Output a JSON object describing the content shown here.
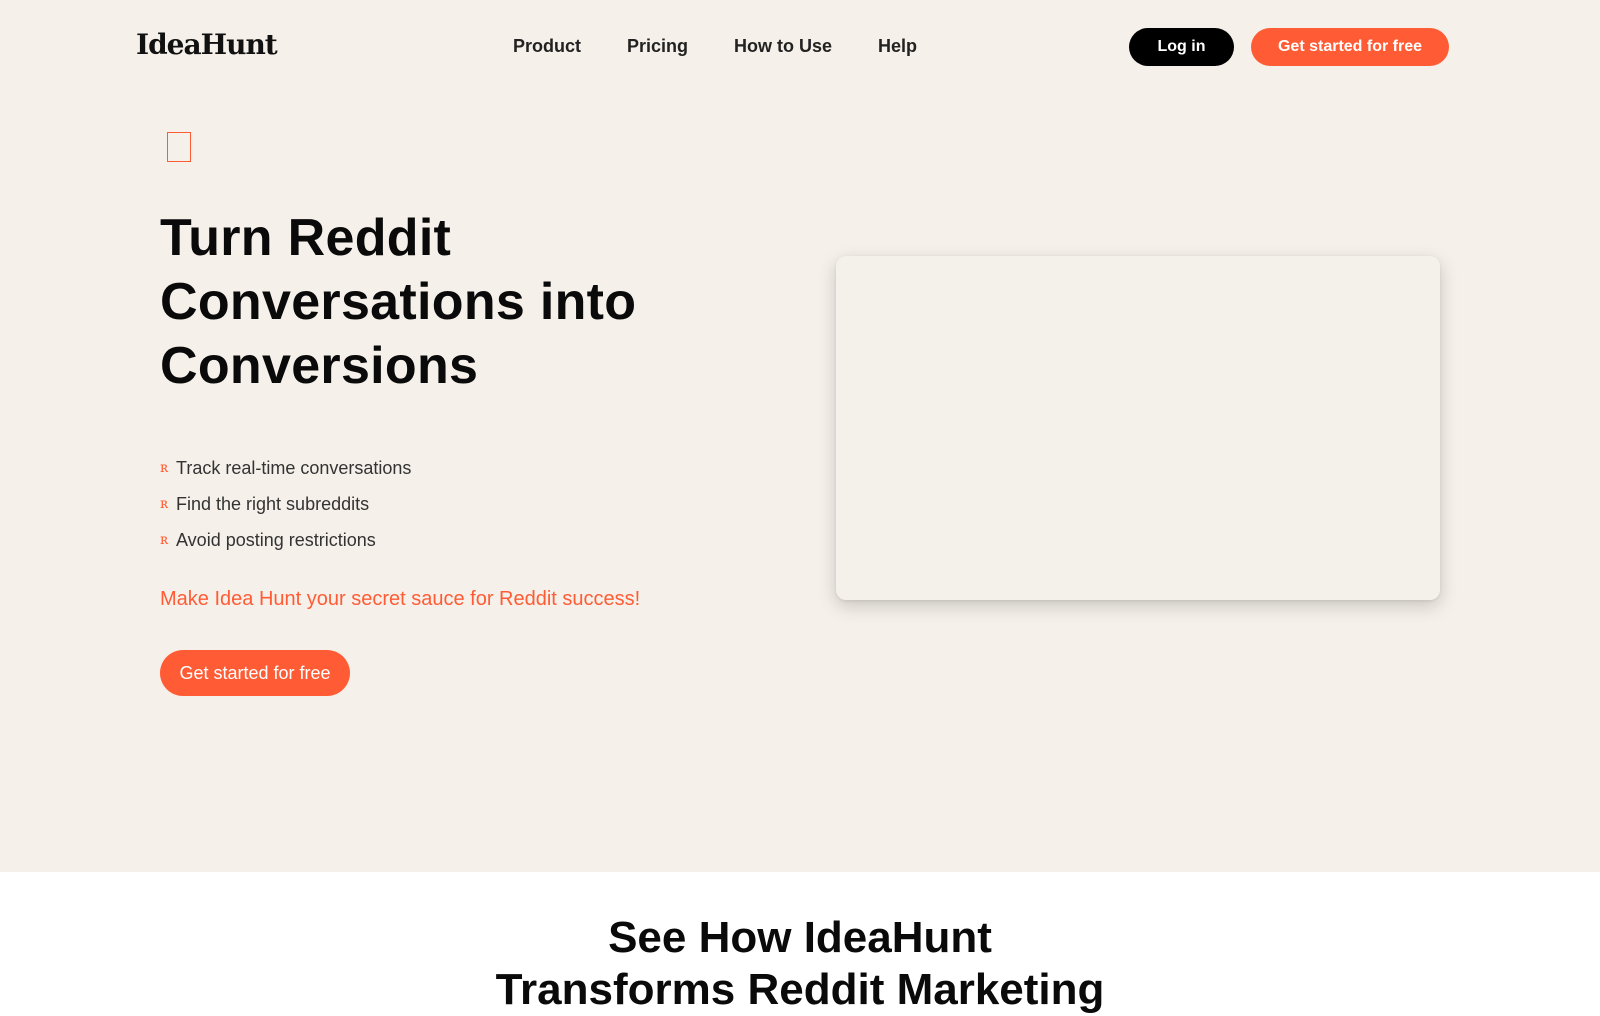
{
  "header": {
    "logo": "IdeaHunt",
    "nav": [
      "Product",
      "Pricing",
      "How to Use",
      "Help"
    ],
    "login_label": "Log in",
    "cta_label": "Get started for free"
  },
  "hero": {
    "title": "Turn Reddit Conversations into Conversions",
    "features": [
      "Track real-time conversations",
      "Find the right subreddits",
      "Avoid posting restrictions"
    ],
    "feature_icon": "reddit-icon",
    "tagline": "Make Idea Hunt your secret sauce for Reddit success!",
    "cta_label": "Get started for free"
  },
  "section": {
    "heading_line1": "See How IdeaHunt",
    "heading_line2": "Transforms Reddit Marketing"
  },
  "colors": {
    "accent": "#ff5c35",
    "hero_background": "#f5f0ea",
    "login_background": "#000000"
  }
}
